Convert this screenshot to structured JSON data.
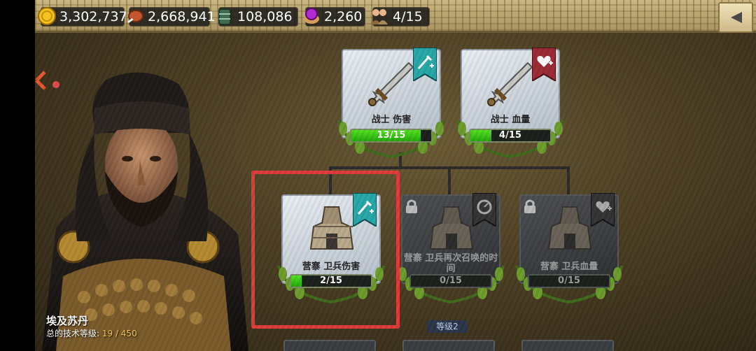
{
  "resources": [
    {
      "icon": "gold-coin-icon",
      "value": "3,302,737"
    },
    {
      "icon": "meat-food-icon",
      "value": "2,668,941"
    },
    {
      "icon": "lumber-icon",
      "value": "108,086"
    },
    {
      "icon": "gem-chest-icon",
      "value": "2,260"
    },
    {
      "icon": "population-icon",
      "value": "4/15"
    }
  ],
  "hero": {
    "name": "埃及苏丹",
    "level_label": "总的技术等级: ",
    "level_value": "19 / 450"
  },
  "tree": {
    "warrior_damage": {
      "label": "战士 伤害",
      "progress": "13/15",
      "fill": 0.8667,
      "ribbon": "sword-plus-icon",
      "ribbon_color": "#27a6a8"
    },
    "warrior_health": {
      "label": "战士 血量",
      "progress": "4/15",
      "fill": 0.2667,
      "ribbon": "heart-plus-icon",
      "ribbon_color": "#9b2a35"
    },
    "guard_damage": {
      "label": "营寨 卫兵伤害",
      "progress": "2/15",
      "fill": 0.1333,
      "ribbon": "sword-plus-icon",
      "ribbon_color": "#27a6a8"
    },
    "guard_respawn": {
      "label": "营寨 卫兵再次召唤的时间",
      "progress": "0/15",
      "fill": 0,
      "ribbon": "timer-icon",
      "ribbon_color": "#333333",
      "locked": true
    },
    "guard_health": {
      "label": "营寨 卫兵血量",
      "progress": "0/15",
      "fill": 0,
      "ribbon": "heart-plus-icon",
      "ribbon_color": "#333333",
      "locked": true
    }
  },
  "tier_label": "等级2",
  "colors": {
    "progress_green": "#3fcf14",
    "highlight_red": "#e03a3a"
  }
}
